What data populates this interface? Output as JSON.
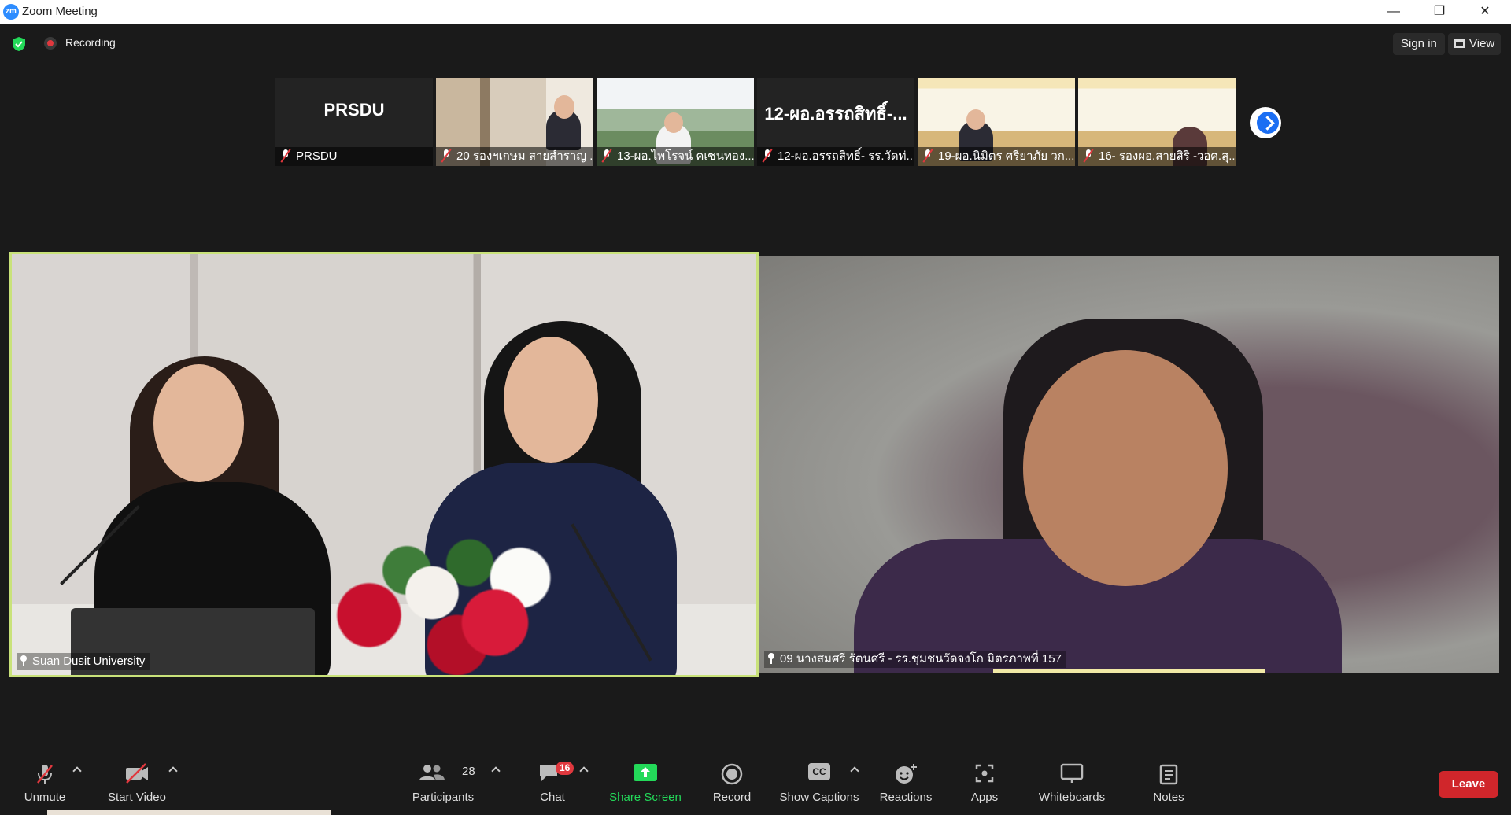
{
  "window": {
    "title": "Zoom Meeting",
    "minimize": "—",
    "restore": "❐",
    "close": "✕"
  },
  "topbar": {
    "recording": "Recording",
    "sign_in": "Sign in",
    "view": "View"
  },
  "thumbnails": [
    {
      "big": "PRSDU",
      "name": "PRSDU"
    },
    {
      "name": "20 รองฯเกษม สายสำราญ ..."
    },
    {
      "name": "13-ผอ.ไพโรจน์ คเซนทอง..."
    },
    {
      "big": "12-ผอ.อรรถสิทธิ์-...",
      "name": "12-ผอ.อรรถสิทธิ์- รร.วัดท่..."
    },
    {
      "name": "19-ผอ.นิมิตร ศรียาภัย วก..."
    },
    {
      "name": "16- รองผอ.สายสิริ -วอศ.สุ..."
    }
  ],
  "videos": {
    "left": {
      "name": "Suan Dusit University"
    },
    "right": {
      "name": "09 นางสมศรี รัตนศรี - รร.ชุมชนวัดจงโก มิตรภาพที่ 157"
    }
  },
  "toolbar": {
    "unmute": "Unmute",
    "start_video": "Start Video",
    "participants": "Participants",
    "participants_count": "28",
    "chat": "Chat",
    "chat_badge": "16",
    "share_screen": "Share Screen",
    "record": "Record",
    "show_captions": "Show Captions",
    "cc": "CC",
    "reactions": "Reactions",
    "apps": "Apps",
    "whiteboards": "Whiteboards",
    "notes": "Notes",
    "leave": "Leave"
  },
  "colors": {
    "accent_green": "#23d959",
    "leave_red": "#d0262b",
    "speaker_border": "#c9e27a",
    "zoom_blue": "#2d8cff"
  }
}
